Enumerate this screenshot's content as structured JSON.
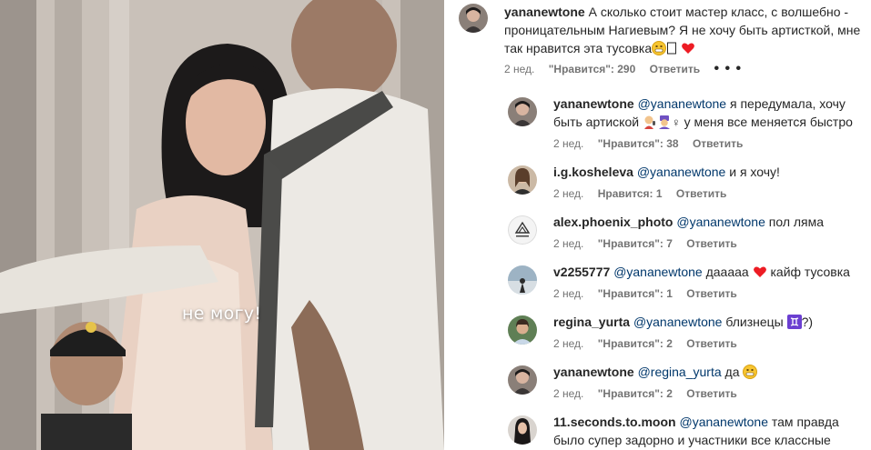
{
  "media": {
    "subtitle": "не могу!"
  },
  "main_comment": {
    "username": "yananewtone",
    "text": "А сколько стоит мастер класс, с волшебно - проницательным Нагиевым? Я не хочу быть артисткой, мне так нравится эта тусовка",
    "time": "2 нед.",
    "likes": "\"Нравится\": 290",
    "reply": "Ответить",
    "more": "• • •"
  },
  "replies": [
    {
      "username": "yananewtone",
      "mention": "@yananewtone",
      "text": "я передумала, хочу быть артиской",
      "text_after": "у меня все меняется быстро",
      "time": "2 нед.",
      "likes": "\"Нравится\": 38",
      "reply": "Ответить",
      "avatar": "avatar-yana"
    },
    {
      "username": "i.g.kosheleva",
      "mention": "@yananewtone",
      "text": "и я хочу!",
      "time": "2 нед.",
      "likes": "Нравится: 1",
      "reply": "Ответить",
      "avatar": "avatar-kosheleva"
    },
    {
      "username": "alex.phoenix_photo",
      "mention": "@yananewtone",
      "text": "пол ляма",
      "time": "2 нед.",
      "likes": "\"Нравится\": 7",
      "reply": "Ответить",
      "avatar": "avatar-phoenix-logo"
    },
    {
      "username": "v2255777",
      "mention": "@yananewtone",
      "text": "дааааа",
      "text_after": "кайф тусовка",
      "time": "2 нед.",
      "likes": "\"Нравится\": 1",
      "reply": "Ответить",
      "avatar": "avatar-v2255777"
    },
    {
      "username": "regina_yurta",
      "mention": "@yananewtone",
      "text": "близнецы",
      "text_after": "?)",
      "time": "2 нед.",
      "likes": "\"Нравится\": 2",
      "reply": "Ответить",
      "avatar": "avatar-regina"
    },
    {
      "username": "yananewtone",
      "mention": "@regina_yurta",
      "text": "да",
      "time": "2 нед.",
      "likes": "\"Нравится\": 2",
      "reply": "Ответить",
      "avatar": "avatar-yana"
    },
    {
      "username": "11.seconds.to.moon",
      "mention": "@yananewtone",
      "text": "там правда было супер задорно и участники все классные люди !",
      "avatar": "avatar-moon"
    }
  ],
  "colors": {
    "mention": "#00376b",
    "meta": "#737373",
    "text": "#262626",
    "heart": "#ed1c24",
    "gemini_badge": "#6b3fd1"
  }
}
